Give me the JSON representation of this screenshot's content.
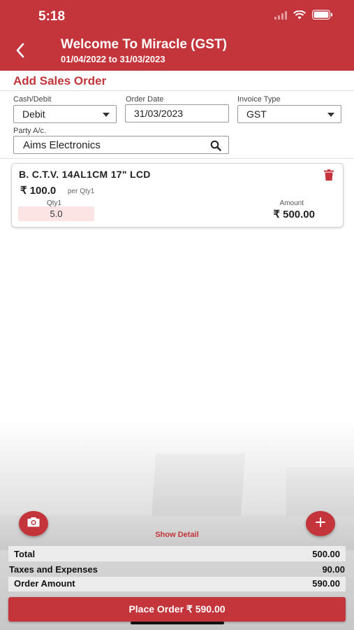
{
  "status_bar": {
    "time": "5:18"
  },
  "header": {
    "title": "Welcome To Miracle (GST)",
    "subtitle": "01/04/2022 to 31/03/2023",
    "back_icon": "chevron-left-icon"
  },
  "page": {
    "title": "Add Sales Order"
  },
  "form": {
    "cash_debit": {
      "label": "Cash/Debit",
      "value": "Debit"
    },
    "order_date": {
      "label": "Order Date",
      "value": "31/03/2023"
    },
    "invoice_type": {
      "label": "Invoice Type",
      "value": "GST"
    },
    "party": {
      "label": "Party A/c.",
      "value": "Aims Electronics",
      "icon": "search-icon"
    }
  },
  "items": [
    {
      "name": "B. C.T.V. 14AL1CM 17\" LCD",
      "price": "₹ 100.0",
      "price_unit": "per Qty1",
      "qty_label": "Qty1",
      "qty": "5.0",
      "amount_label": "Amount",
      "amount": "₹ 500.00",
      "delete_icon": "trash-icon"
    }
  ],
  "actions": {
    "camera_icon": "camera-icon",
    "add_icon": "plus-icon",
    "show_detail": "Show Detail",
    "place_order": "Place Order  ₹ 590.00"
  },
  "summary": {
    "total_label": "Total",
    "total_value": "500.00",
    "taxes_label": "Taxes and Expenses",
    "taxes_value": "90.00",
    "order_amount_label": "Order Amount",
    "order_amount_value": "590.00"
  },
  "colors": {
    "accent": "#c3353a",
    "qty_bg": "#fde4e4"
  }
}
